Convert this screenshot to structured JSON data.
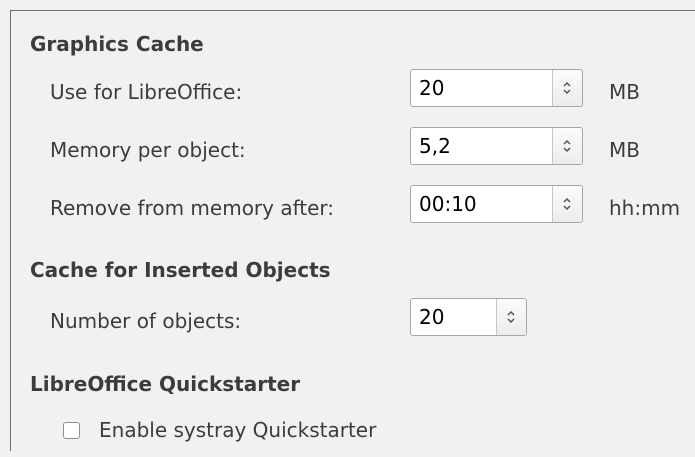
{
  "graphics_cache": {
    "title": "Graphics Cache",
    "use_for": {
      "label": "Use for LibreOffice:",
      "value": "20",
      "unit": "MB"
    },
    "memory_per_object": {
      "label": "Memory per object:",
      "value": "5,2",
      "unit": "MB"
    },
    "remove_after": {
      "label": "Remove from memory after:",
      "value": "00:10",
      "unit": "hh:mm"
    }
  },
  "inserted_objects_cache": {
    "title": "Cache for Inserted Objects",
    "number_of_objects": {
      "label": "Number of objects:",
      "value": "20"
    }
  },
  "quickstarter": {
    "title": "LibreOffice Quickstarter",
    "enable_systray": {
      "label": "Enable systray Quickstarter",
      "checked": false
    }
  },
  "colors": {
    "background": "#f2f1f0",
    "text": "#3c3c3c",
    "field_border": "#a6a6a6"
  }
}
